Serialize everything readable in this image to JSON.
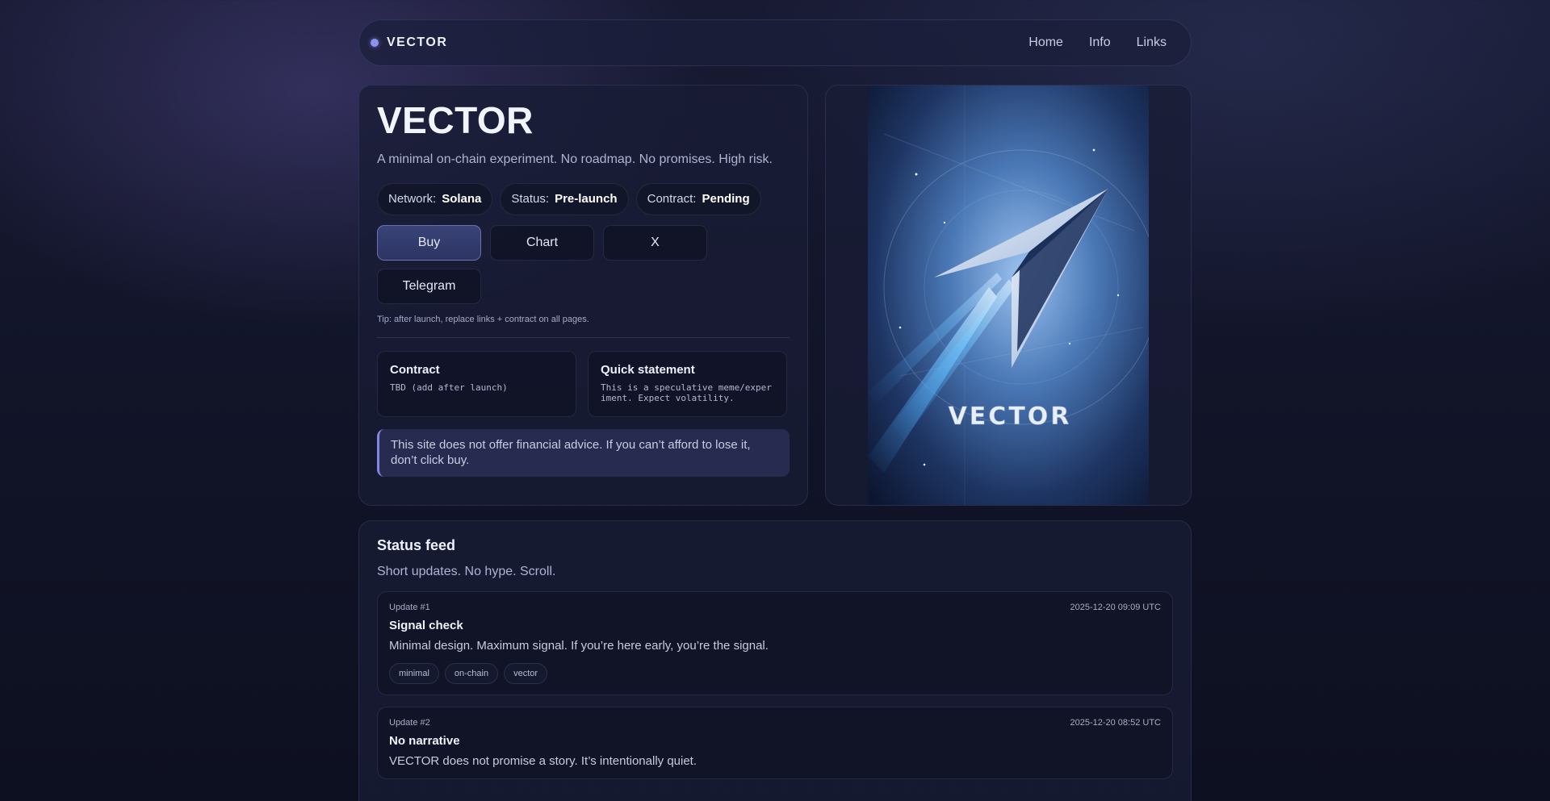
{
  "nav": {
    "brand": "VECTOR",
    "links": [
      "Home",
      "Info",
      "Links"
    ]
  },
  "hero": {
    "title": "VECTOR",
    "subtitle": "A minimal on-chain experiment. No roadmap. No promises. High risk.",
    "pills": [
      {
        "label": "Network:",
        "value": "Solana"
      },
      {
        "label": "Status:",
        "value": "Pre-launch"
      },
      {
        "label": "Contract:",
        "value": "Pending"
      }
    ],
    "buttons": [
      "Buy",
      "Chart",
      "X",
      "Telegram"
    ],
    "tip": "Tip: after launch, replace links + contract on all pages.",
    "contract": {
      "title": "Contract",
      "text": "TBD (add after launch)"
    },
    "statement": {
      "title": "Quick statement",
      "text": "This is a speculative meme/experiment. Expect volatility."
    },
    "notice": "This site does not offer financial advice. If you can’t afford to lose it, don’t click buy."
  },
  "poster": {
    "wordmark": "VECTOR",
    "accent": "#6fb3ff"
  },
  "feed": {
    "title": "Status feed",
    "subtitle": "Short updates. No hype. Scroll.",
    "updates": [
      {
        "label": "Update #1",
        "time": "2025-12-20 09:09 UTC",
        "title": "Signal check",
        "text": "Minimal design. Maximum signal. If you’re here early, you’re the signal.",
        "tags": [
          "minimal",
          "on-chain",
          "vector"
        ]
      },
      {
        "label": "Update #2",
        "time": "2025-12-20 08:52 UTC",
        "title": "No narrative",
        "text": "VECTOR does not promise a story. It’s intentionally quiet."
      }
    ]
  },
  "colors": {
    "accent": "#8c92ef",
    "background": "#121529",
    "card": "#181c34"
  }
}
